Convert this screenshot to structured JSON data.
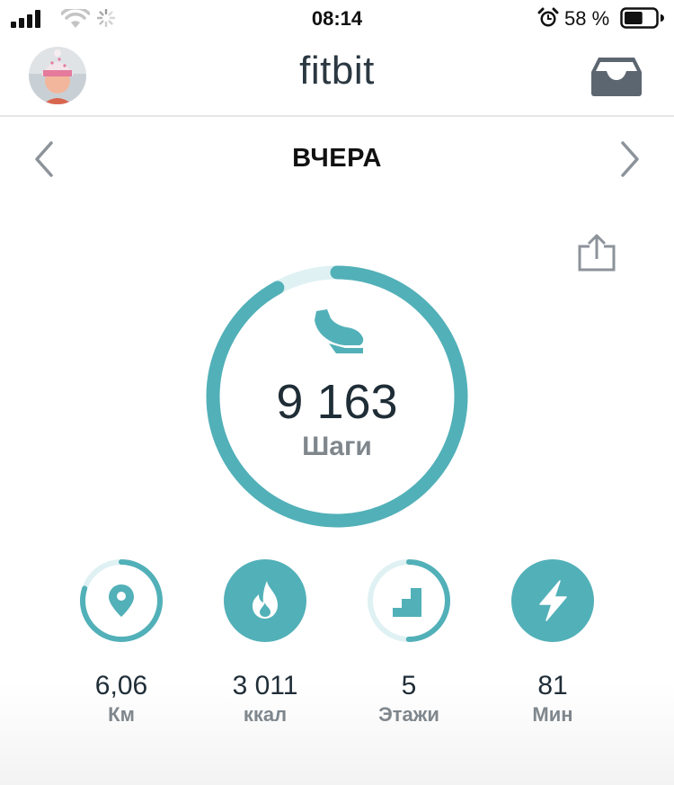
{
  "status_bar": {
    "time": "08:14",
    "battery_percent": "58 %",
    "battery_level": 0.58,
    "icons": [
      "signal-icon",
      "wifi-icon",
      "loading-spinner-icon",
      "alarm-icon",
      "battery-icon"
    ]
  },
  "header": {
    "brand": "fitbit",
    "avatar_icon": "profile-avatar",
    "inbox_icon": "inbox-icon"
  },
  "date_nav": {
    "title": "ВЧЕРА",
    "prev_icon": "chevron-left-icon",
    "next_icon": "chevron-right-icon"
  },
  "share_icon": "share-icon",
  "steps": {
    "value": "9 163",
    "unit": "Шаги",
    "progress": 0.92,
    "icon": "shoe-icon"
  },
  "stats": [
    {
      "value": "6,06",
      "unit": "Км",
      "icon": "location-pin-icon",
      "progress": 0.8
    },
    {
      "value": "3 011",
      "unit": "ккал",
      "icon": "flame-icon",
      "progress": 1.0
    },
    {
      "value": "5",
      "unit": "Этажи",
      "icon": "stairs-icon",
      "progress": 0.5
    },
    {
      "value": "81",
      "unit": "Мин",
      "icon": "lightning-icon",
      "progress": 1.0
    }
  ],
  "colors": {
    "accent": "#52b0b8",
    "track": "#dff1f3",
    "text_dark": "#1f2d37",
    "text_muted": "#7f878d"
  }
}
